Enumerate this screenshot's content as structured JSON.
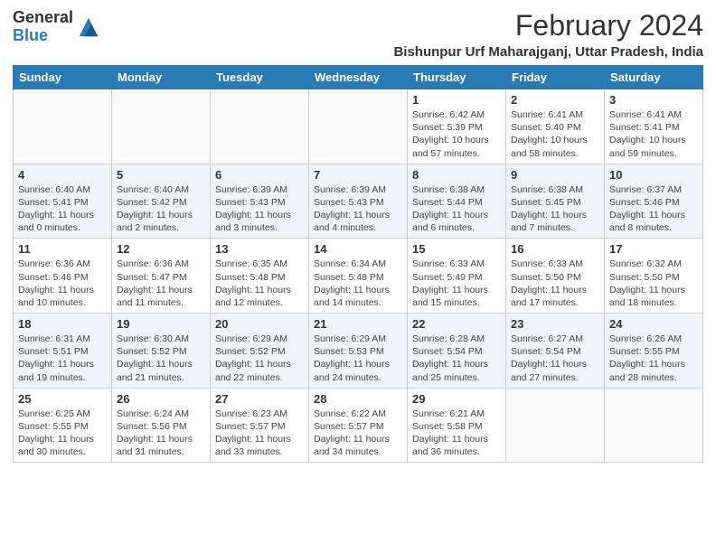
{
  "logo": {
    "general": "General",
    "blue": "Blue"
  },
  "title": "February 2024",
  "subtitle": "Bishunpur Urf Maharajganj, Uttar Pradesh, India",
  "weekdays": [
    "Sunday",
    "Monday",
    "Tuesday",
    "Wednesday",
    "Thursday",
    "Friday",
    "Saturday"
  ],
  "weeks": [
    [
      {
        "day": "",
        "info": ""
      },
      {
        "day": "",
        "info": ""
      },
      {
        "day": "",
        "info": ""
      },
      {
        "day": "",
        "info": ""
      },
      {
        "day": "1",
        "info": "Sunrise: 6:42 AM\nSunset: 5:39 PM\nDaylight: 10 hours\nand 57 minutes."
      },
      {
        "day": "2",
        "info": "Sunrise: 6:41 AM\nSunset: 5:40 PM\nDaylight: 10 hours\nand 58 minutes."
      },
      {
        "day": "3",
        "info": "Sunrise: 6:41 AM\nSunset: 5:41 PM\nDaylight: 10 hours\nand 59 minutes."
      }
    ],
    [
      {
        "day": "4",
        "info": "Sunrise: 6:40 AM\nSunset: 5:41 PM\nDaylight: 11 hours\nand 0 minutes."
      },
      {
        "day": "5",
        "info": "Sunrise: 6:40 AM\nSunset: 5:42 PM\nDaylight: 11 hours\nand 2 minutes."
      },
      {
        "day": "6",
        "info": "Sunrise: 6:39 AM\nSunset: 5:43 PM\nDaylight: 11 hours\nand 3 minutes."
      },
      {
        "day": "7",
        "info": "Sunrise: 6:39 AM\nSunset: 5:43 PM\nDaylight: 11 hours\nand 4 minutes."
      },
      {
        "day": "8",
        "info": "Sunrise: 6:38 AM\nSunset: 5:44 PM\nDaylight: 11 hours\nand 6 minutes."
      },
      {
        "day": "9",
        "info": "Sunrise: 6:38 AM\nSunset: 5:45 PM\nDaylight: 11 hours\nand 7 minutes."
      },
      {
        "day": "10",
        "info": "Sunrise: 6:37 AM\nSunset: 5:46 PM\nDaylight: 11 hours\nand 8 minutes."
      }
    ],
    [
      {
        "day": "11",
        "info": "Sunrise: 6:36 AM\nSunset: 5:46 PM\nDaylight: 11 hours\nand 10 minutes."
      },
      {
        "day": "12",
        "info": "Sunrise: 6:36 AM\nSunset: 5:47 PM\nDaylight: 11 hours\nand 11 minutes."
      },
      {
        "day": "13",
        "info": "Sunrise: 6:35 AM\nSunset: 5:48 PM\nDaylight: 11 hours\nand 12 minutes."
      },
      {
        "day": "14",
        "info": "Sunrise: 6:34 AM\nSunset: 5:48 PM\nDaylight: 11 hours\nand 14 minutes."
      },
      {
        "day": "15",
        "info": "Sunrise: 6:33 AM\nSunset: 5:49 PM\nDaylight: 11 hours\nand 15 minutes."
      },
      {
        "day": "16",
        "info": "Sunrise: 6:33 AM\nSunset: 5:50 PM\nDaylight: 11 hours\nand 17 minutes."
      },
      {
        "day": "17",
        "info": "Sunrise: 6:32 AM\nSunset: 5:50 PM\nDaylight: 11 hours\nand 18 minutes."
      }
    ],
    [
      {
        "day": "18",
        "info": "Sunrise: 6:31 AM\nSunset: 5:51 PM\nDaylight: 11 hours\nand 19 minutes."
      },
      {
        "day": "19",
        "info": "Sunrise: 6:30 AM\nSunset: 5:52 PM\nDaylight: 11 hours\nand 21 minutes."
      },
      {
        "day": "20",
        "info": "Sunrise: 6:29 AM\nSunset: 5:52 PM\nDaylight: 11 hours\nand 22 minutes."
      },
      {
        "day": "21",
        "info": "Sunrise: 6:29 AM\nSunset: 5:53 PM\nDaylight: 11 hours\nand 24 minutes."
      },
      {
        "day": "22",
        "info": "Sunrise: 6:28 AM\nSunset: 5:54 PM\nDaylight: 11 hours\nand 25 minutes."
      },
      {
        "day": "23",
        "info": "Sunrise: 6:27 AM\nSunset: 5:54 PM\nDaylight: 11 hours\nand 27 minutes."
      },
      {
        "day": "24",
        "info": "Sunrise: 6:26 AM\nSunset: 5:55 PM\nDaylight: 11 hours\nand 28 minutes."
      }
    ],
    [
      {
        "day": "25",
        "info": "Sunrise: 6:25 AM\nSunset: 5:55 PM\nDaylight: 11 hours\nand 30 minutes."
      },
      {
        "day": "26",
        "info": "Sunrise: 6:24 AM\nSunset: 5:56 PM\nDaylight: 11 hours\nand 31 minutes."
      },
      {
        "day": "27",
        "info": "Sunrise: 6:23 AM\nSunset: 5:57 PM\nDaylight: 11 hours\nand 33 minutes."
      },
      {
        "day": "28",
        "info": "Sunrise: 6:22 AM\nSunset: 5:57 PM\nDaylight: 11 hours\nand 34 minutes."
      },
      {
        "day": "29",
        "info": "Sunrise: 6:21 AM\nSunset: 5:58 PM\nDaylight: 11 hours\nand 36 minutes."
      },
      {
        "day": "",
        "info": ""
      },
      {
        "day": "",
        "info": ""
      }
    ]
  ]
}
